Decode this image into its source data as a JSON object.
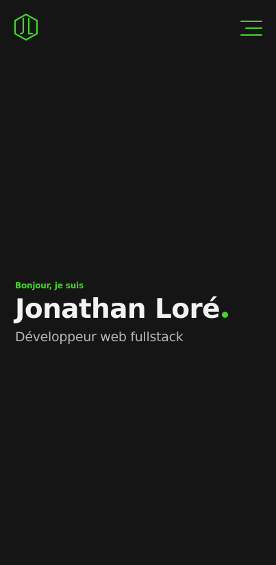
{
  "header": {
    "logo_icon": "jl-hexagon-logo-icon",
    "menu_icon": "hamburger-menu-icon"
  },
  "hero": {
    "greeting": "Bonjour, je suis",
    "name": "Jonathan Loré",
    "subtitle": "Développeur web fullstack"
  },
  "colors": {
    "background": "#151515",
    "accent": "#41d728",
    "text": "#f3f3f3",
    "muted": "#b5b5b5"
  }
}
